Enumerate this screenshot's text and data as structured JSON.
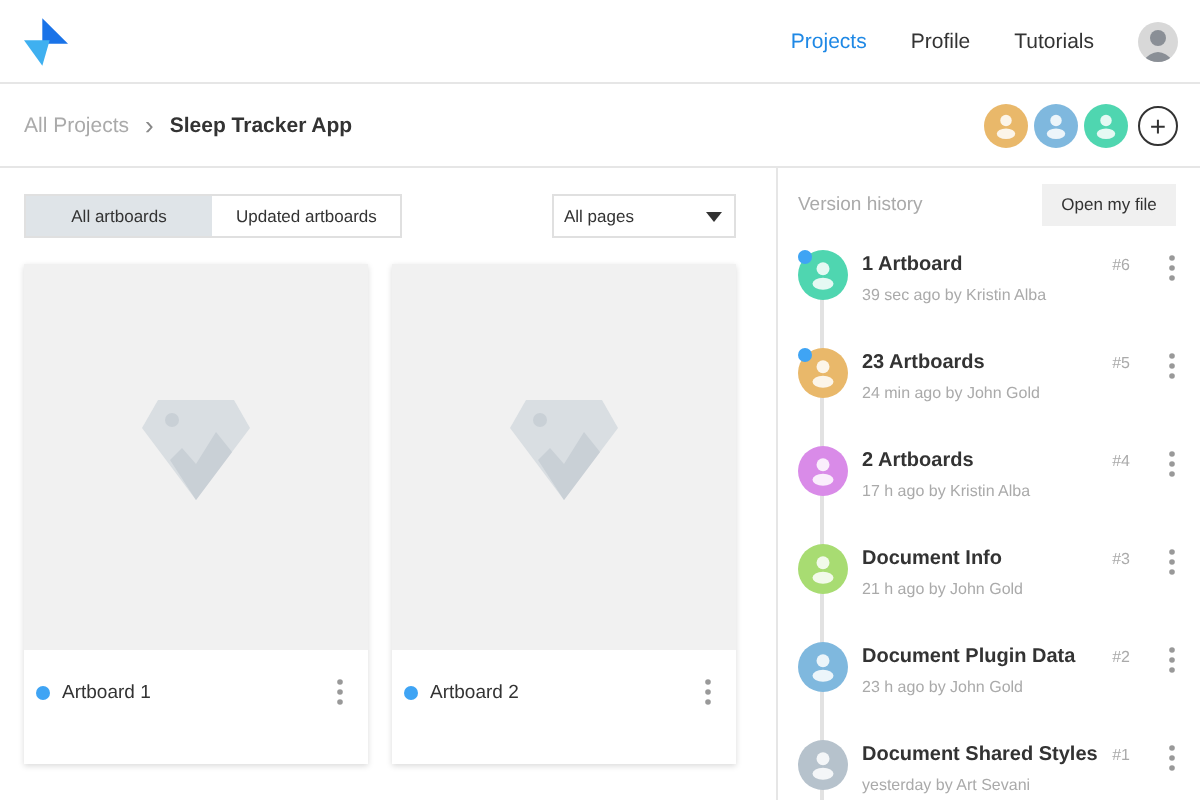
{
  "nav": [
    {
      "label": "Projects",
      "selected": true
    },
    {
      "label": "Profile",
      "selected": false
    },
    {
      "label": "Tutorials",
      "selected": false
    }
  ],
  "breadcrumb": {
    "parent": "All Projects",
    "separator": "›",
    "current": "Sleep Tracker App"
  },
  "collaborators": [
    {
      "color": "#e9b86a"
    },
    {
      "color": "#7fb8de"
    },
    {
      "color": "#4fd6b0"
    }
  ],
  "add_button": "+",
  "filter_tabs": [
    {
      "label": "All artboards",
      "selected": true
    },
    {
      "label": "Updated artboards",
      "selected": false
    }
  ],
  "pages_dropdown": {
    "value": "All pages"
  },
  "artboards": [
    {
      "label": "Artboard 1",
      "color": "#3fa4f4"
    },
    {
      "label": "Artboard 2",
      "color": "#3fa4f4"
    }
  ],
  "version_history": {
    "title": "Version history",
    "button": "Open my file",
    "versions": [
      {
        "title": "1 Artboard",
        "meta": "39 sec ago by Kristin Alba",
        "number": "#6",
        "color": "#4fd6b0",
        "new": true
      },
      {
        "title": "23 Artboards",
        "meta": "24 min ago by John Gold",
        "number": "#5",
        "color": "#e9b86a",
        "new": true
      },
      {
        "title": "2 Artboards",
        "meta": "17 h ago by Kristin Alba",
        "number": "#4",
        "color": "#d98be8",
        "new": false
      },
      {
        "title": "Document Info",
        "meta": "21 h ago by John Gold",
        "number": "#3",
        "color": "#a8dc72",
        "new": false
      },
      {
        "title": "Document Plugin Data",
        "meta": "23 h ago by John Gold",
        "number": "#2",
        "color": "#7fb8de",
        "new": false
      },
      {
        "title": "Document Shared Styles",
        "meta": "yesterday by Art Sevani",
        "number": "#1",
        "color": "#b6c2cc",
        "new": false
      }
    ]
  }
}
